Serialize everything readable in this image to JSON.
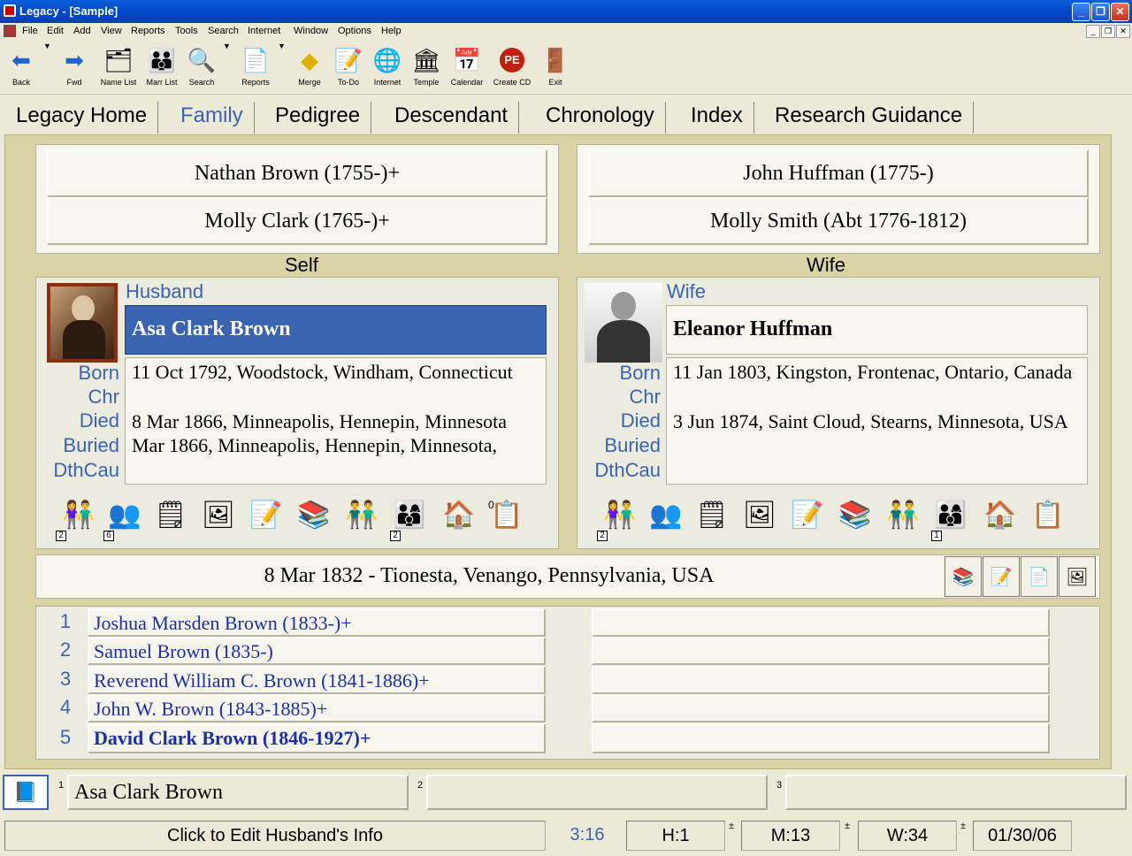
{
  "window": {
    "title": "Legacy - [Sample]"
  },
  "menu": [
    "File",
    "Edit",
    "Add",
    "View",
    "Reports",
    "Tools",
    "Search",
    "Internet",
    "Window",
    "Options",
    "Help"
  ],
  "toolbar": {
    "back": "Back",
    "fwd": "Fwd",
    "name_list": "Name List",
    "marr_list": "Marr List",
    "search": "Search",
    "reports": "Reports",
    "merge": "Merge",
    "todo": "To-Do",
    "internet": "Internet",
    "temple": "Temple",
    "calendar": "Calendar",
    "create_cd": "Create CD",
    "exit": "Exit"
  },
  "tabs": [
    "Legacy Home",
    "Family",
    "Pedigree",
    "Descendant",
    "Chronology",
    "Index",
    "Research Guidance"
  ],
  "active_tab": "Family",
  "parents": {
    "husband_father": "Nathan Brown (1755-)+",
    "husband_mother": "Molly Clark (1765-)+",
    "wife_father": "John Huffman (1775-)",
    "wife_mother": "Molly Smith (Abt 1776-1812)"
  },
  "self_label": "Self",
  "wife_label": "Wife",
  "husband": {
    "role": "Husband",
    "name": "Asa Clark Brown",
    "event_labels": [
      "Born",
      "Chr",
      "Died",
      "Buried",
      "DthCau"
    ],
    "born": "11 Oct 1792, Woodstock, Windham, Connecticut",
    "chr": "",
    "died": "8 Mar 1866, Minneapolis, Hennepin, Minnesota",
    "buried": "Mar 1866, Minneapolis, Hennepin, Minnesota,",
    "dthcau": "",
    "counts": {
      "spouses": "2",
      "parents": "6",
      "siblings": "2",
      "todo": "0"
    }
  },
  "wife": {
    "role": "Wife",
    "name": "Eleanor Huffman",
    "event_labels": [
      "Born",
      "Chr",
      "Died",
      "Buried",
      "DthCau"
    ],
    "born": "11 Jan 1803, Kingston, Frontenac, Ontario, Canada",
    "chr": "",
    "died": "3 Jun 1874, Saint Cloud, Stearns, Minnesota, USA",
    "buried": "",
    "dthcau": "",
    "counts": {
      "spouses": "2",
      "siblings": "1"
    }
  },
  "marriage": "8 Mar 1832 - Tionesta, Venango, Pennsylvania, USA",
  "children": [
    {
      "num": "1",
      "name": "Joshua Marsden Brown (1833-)+"
    },
    {
      "num": "2",
      "name": "Samuel Brown (1835-)"
    },
    {
      "num": "3",
      "name": "Reverend William C. Brown (1841-1886)+"
    },
    {
      "num": "4",
      "name": "John W. Brown (1843-1885)+"
    },
    {
      "num": "5",
      "name": "David Clark Brown (1846-1927)+"
    }
  ],
  "bookmarks": [
    {
      "num": "1",
      "name": "Asa Clark Brown"
    },
    {
      "num": "2",
      "name": ""
    },
    {
      "num": "3",
      "name": ""
    }
  ],
  "status": {
    "hint": "Click to Edit Husband's Info",
    "ratio": "3:16",
    "h": "H:1",
    "m": "M:13",
    "w": "W:34",
    "date": "01/30/06"
  },
  "colors": {
    "accent": "#3a63b0",
    "selected_name_bg": "#3a63b0",
    "main_bg": "#d9d4a6",
    "child_link": "#1a2fb0"
  }
}
